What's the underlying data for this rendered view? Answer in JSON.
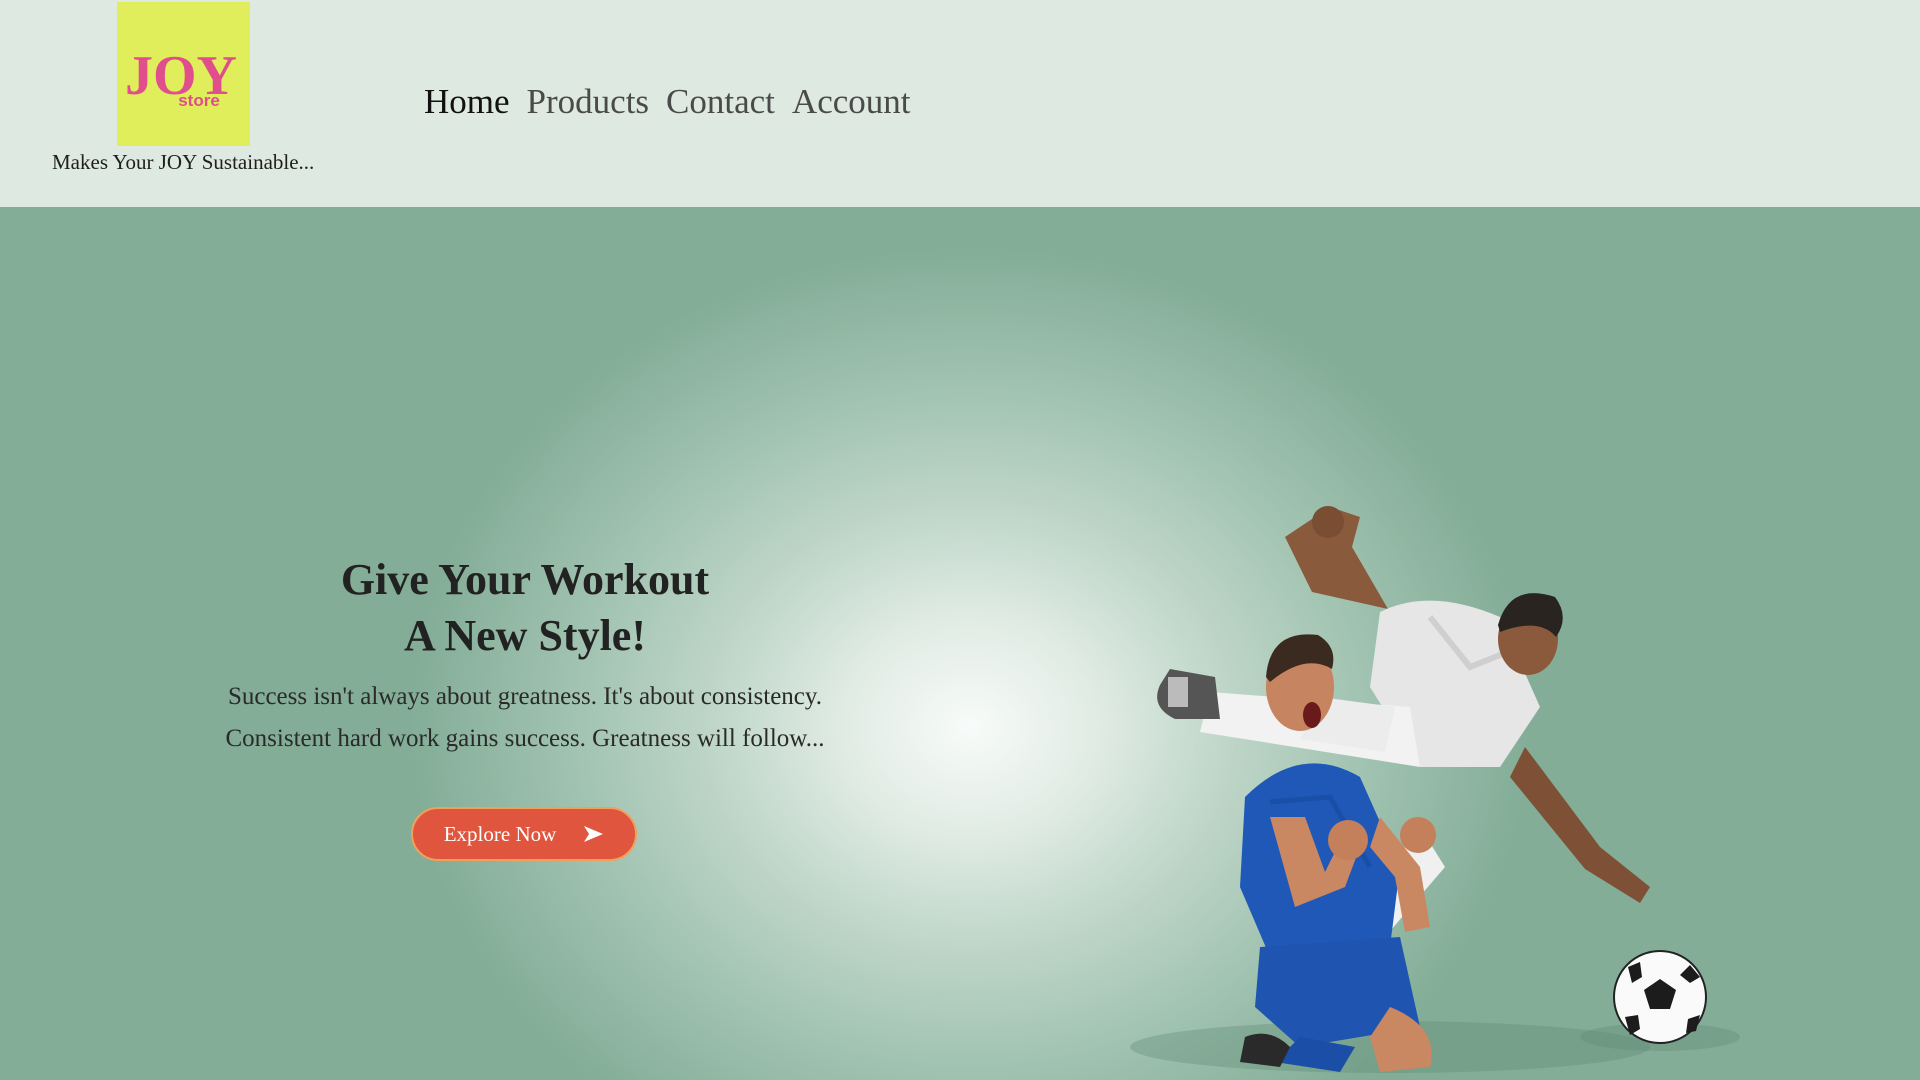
{
  "header": {
    "logo": {
      "word": "JOY",
      "sub": "store",
      "bg": "#e1ee5c",
      "text_color": "#e04f8c"
    },
    "tagline": "Makes Your JOY Sustainable...",
    "nav": [
      {
        "label": "Home",
        "active": true
      },
      {
        "label": "Products",
        "active": false
      },
      {
        "label": "Contact",
        "active": false
      },
      {
        "label": "Account",
        "active": false
      }
    ]
  },
  "hero": {
    "title_line1": "Give Your Workout",
    "title_line2": "A New Style!",
    "subtitle_line1": "Success isn't always about greatness. It's about consistency.",
    "subtitle_line2": "Consistent hard work gains success. Greatness will follow...",
    "cta_label": "Explore Now",
    "cta_icon": "arrow-right-icon",
    "cta_color": "#e0553d",
    "image_subject": "two-football-players"
  }
}
